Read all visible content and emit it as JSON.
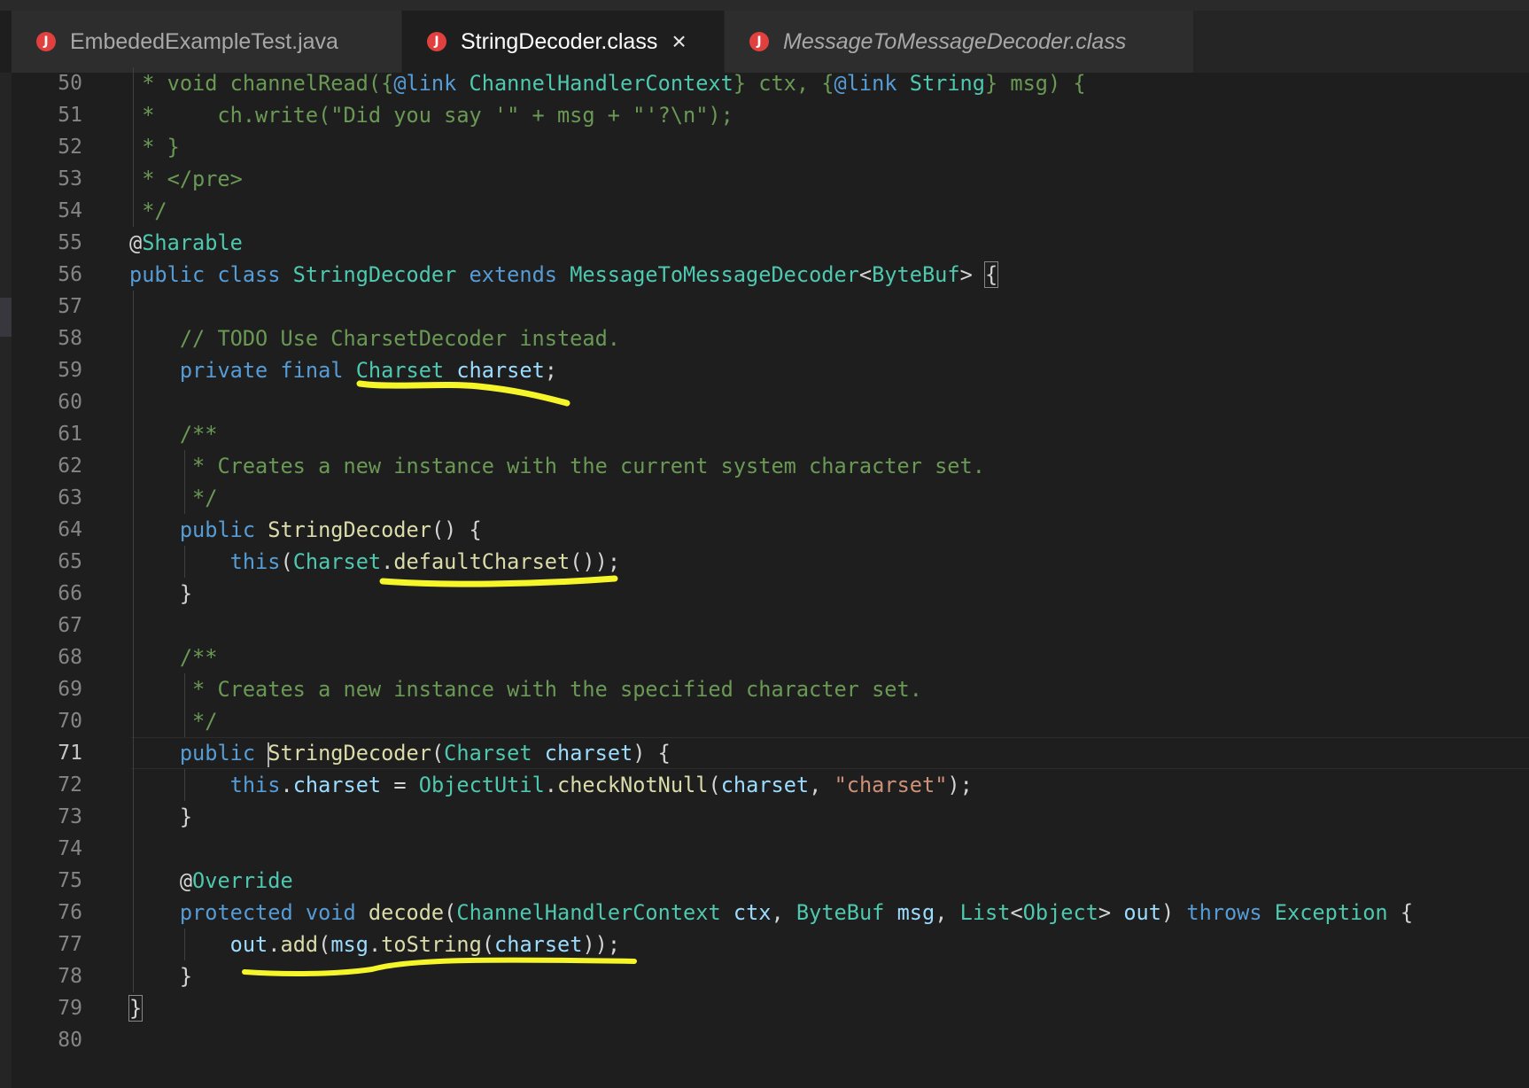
{
  "tabs": [
    {
      "label": "EmbededExampleTest.java",
      "active": false,
      "italic": false,
      "icon": "java-file-icon"
    },
    {
      "label": "StringDecoder.class",
      "active": true,
      "italic": false,
      "icon": "java-file-icon",
      "closable": true
    },
    {
      "label": "MessageToMessageDecoder.class",
      "active": false,
      "italic": true,
      "icon": "java-file-icon"
    }
  ],
  "close_glyph": "×",
  "icon_glyph": "J",
  "current_line": 71,
  "lines": [
    {
      "n": "50",
      "tokens": [
        [
          "com",
          " * void channelRead({"
        ],
        [
          "link",
          "@link"
        ],
        [
          "type",
          " ChannelHandlerContext"
        ],
        [
          "com",
          "} ctx, {"
        ],
        [
          "link",
          "@link"
        ],
        [
          "type",
          " String"
        ],
        [
          "com",
          "} msg) {"
        ]
      ]
    },
    {
      "n": "51",
      "tokens": [
        [
          "com",
          " *     ch.write(\"Did you say '\" + msg + \"'?\\n\");"
        ]
      ]
    },
    {
      "n": "52",
      "tokens": [
        [
          "com",
          " * }"
        ]
      ]
    },
    {
      "n": "53",
      "tokens": [
        [
          "com",
          " * </pre>"
        ]
      ]
    },
    {
      "n": "54",
      "tokens": [
        [
          "com",
          " */"
        ]
      ]
    },
    {
      "n": "55",
      "tokens": [
        [
          "plain",
          "@"
        ],
        [
          "ann",
          "Sharable"
        ]
      ]
    },
    {
      "n": "56",
      "tokens": [
        [
          "kw",
          "public class "
        ],
        [
          "type",
          "StringDecoder "
        ],
        [
          "kw",
          "extends "
        ],
        [
          "type",
          "MessageToMessageDecoder"
        ],
        [
          "plain",
          "<"
        ],
        [
          "type",
          "ByteBuf"
        ],
        [
          "plain",
          "> "
        ],
        [
          "box",
          "{"
        ]
      ]
    },
    {
      "n": "57",
      "tokens": []
    },
    {
      "n": "58",
      "tokens": [
        [
          "plain",
          "    "
        ],
        [
          "com",
          "// TODO Use CharsetDecoder instead."
        ]
      ]
    },
    {
      "n": "59",
      "tokens": [
        [
          "plain",
          "    "
        ],
        [
          "kw",
          "private final "
        ],
        [
          "type",
          "Charset "
        ],
        [
          "var",
          "charset"
        ],
        [
          "plain",
          ";"
        ]
      ]
    },
    {
      "n": "60",
      "tokens": []
    },
    {
      "n": "61",
      "tokens": [
        [
          "plain",
          "    "
        ],
        [
          "com",
          "/**"
        ]
      ]
    },
    {
      "n": "62",
      "tokens": [
        [
          "plain",
          "    "
        ],
        [
          "com",
          " * Creates a new instance with the current system character set."
        ]
      ]
    },
    {
      "n": "63",
      "tokens": [
        [
          "plain",
          "    "
        ],
        [
          "com",
          " */"
        ]
      ]
    },
    {
      "n": "64",
      "tokens": [
        [
          "plain",
          "    "
        ],
        [
          "kw",
          "public "
        ],
        [
          "fn",
          "StringDecoder"
        ],
        [
          "plain",
          "() {"
        ]
      ]
    },
    {
      "n": "65",
      "tokens": [
        [
          "plain",
          "        "
        ],
        [
          "kw",
          "this"
        ],
        [
          "plain",
          "("
        ],
        [
          "type",
          "Charset"
        ],
        [
          "plain",
          "."
        ],
        [
          "fn",
          "defaultCharset"
        ],
        [
          "plain",
          "());"
        ]
      ]
    },
    {
      "n": "66",
      "tokens": [
        [
          "plain",
          "    }"
        ]
      ]
    },
    {
      "n": "67",
      "tokens": []
    },
    {
      "n": "68",
      "tokens": [
        [
          "plain",
          "    "
        ],
        [
          "com",
          "/**"
        ]
      ]
    },
    {
      "n": "69",
      "tokens": [
        [
          "plain",
          "    "
        ],
        [
          "com",
          " * Creates a new instance with the specified character set."
        ]
      ]
    },
    {
      "n": "70",
      "tokens": [
        [
          "plain",
          "    "
        ],
        [
          "com",
          " */"
        ]
      ]
    },
    {
      "n": "71",
      "tokens": [
        [
          "plain",
          "    "
        ],
        [
          "kw",
          "public "
        ],
        [
          "cursor",
          ""
        ],
        [
          "fn",
          "StringDecoder"
        ],
        [
          "plain",
          "("
        ],
        [
          "type",
          "Charset "
        ],
        [
          "var",
          "charset"
        ],
        [
          "plain",
          ") {"
        ]
      ]
    },
    {
      "n": "72",
      "tokens": [
        [
          "plain",
          "        "
        ],
        [
          "kw",
          "this"
        ],
        [
          "plain",
          "."
        ],
        [
          "var",
          "charset"
        ],
        [
          "plain",
          " = "
        ],
        [
          "type",
          "ObjectUtil"
        ],
        [
          "plain",
          "."
        ],
        [
          "fn",
          "checkNotNull"
        ],
        [
          "plain",
          "("
        ],
        [
          "var",
          "charset"
        ],
        [
          "plain",
          ", "
        ],
        [
          "str",
          "\"charset\""
        ],
        [
          "plain",
          ");"
        ]
      ]
    },
    {
      "n": "73",
      "tokens": [
        [
          "plain",
          "    }"
        ]
      ]
    },
    {
      "n": "74",
      "tokens": []
    },
    {
      "n": "75",
      "tokens": [
        [
          "plain",
          "    @"
        ],
        [
          "ann",
          "Override"
        ]
      ]
    },
    {
      "n": "76",
      "tokens": [
        [
          "plain",
          "    "
        ],
        [
          "kw",
          "protected void "
        ],
        [
          "fn",
          "decode"
        ],
        [
          "plain",
          "("
        ],
        [
          "type",
          "ChannelHandlerContext "
        ],
        [
          "var",
          "ctx"
        ],
        [
          "plain",
          ", "
        ],
        [
          "type",
          "ByteBuf "
        ],
        [
          "var",
          "msg"
        ],
        [
          "plain",
          ", "
        ],
        [
          "type",
          "List"
        ],
        [
          "plain",
          "<"
        ],
        [
          "type",
          "Object"
        ],
        [
          "plain",
          "> "
        ],
        [
          "var",
          "out"
        ],
        [
          "plain",
          ") "
        ],
        [
          "kw",
          "throws "
        ],
        [
          "type",
          "Exception"
        ],
        [
          "plain",
          " {"
        ]
      ]
    },
    {
      "n": "77",
      "tokens": [
        [
          "plain",
          "        "
        ],
        [
          "var",
          "out"
        ],
        [
          "plain",
          "."
        ],
        [
          "fn",
          "add"
        ],
        [
          "plain",
          "("
        ],
        [
          "var",
          "msg"
        ],
        [
          "plain",
          "."
        ],
        [
          "fn",
          "toString"
        ],
        [
          "plain",
          "("
        ],
        [
          "var",
          "charset"
        ],
        [
          "plain",
          "));"
        ]
      ]
    },
    {
      "n": "78",
      "tokens": [
        [
          "plain",
          "    }"
        ]
      ]
    },
    {
      "n": "79",
      "tokens": [
        [
          "box",
          "}"
        ]
      ]
    },
    {
      "n": "80",
      "tokens": []
    }
  ],
  "highlight_color": "#f5f52a"
}
